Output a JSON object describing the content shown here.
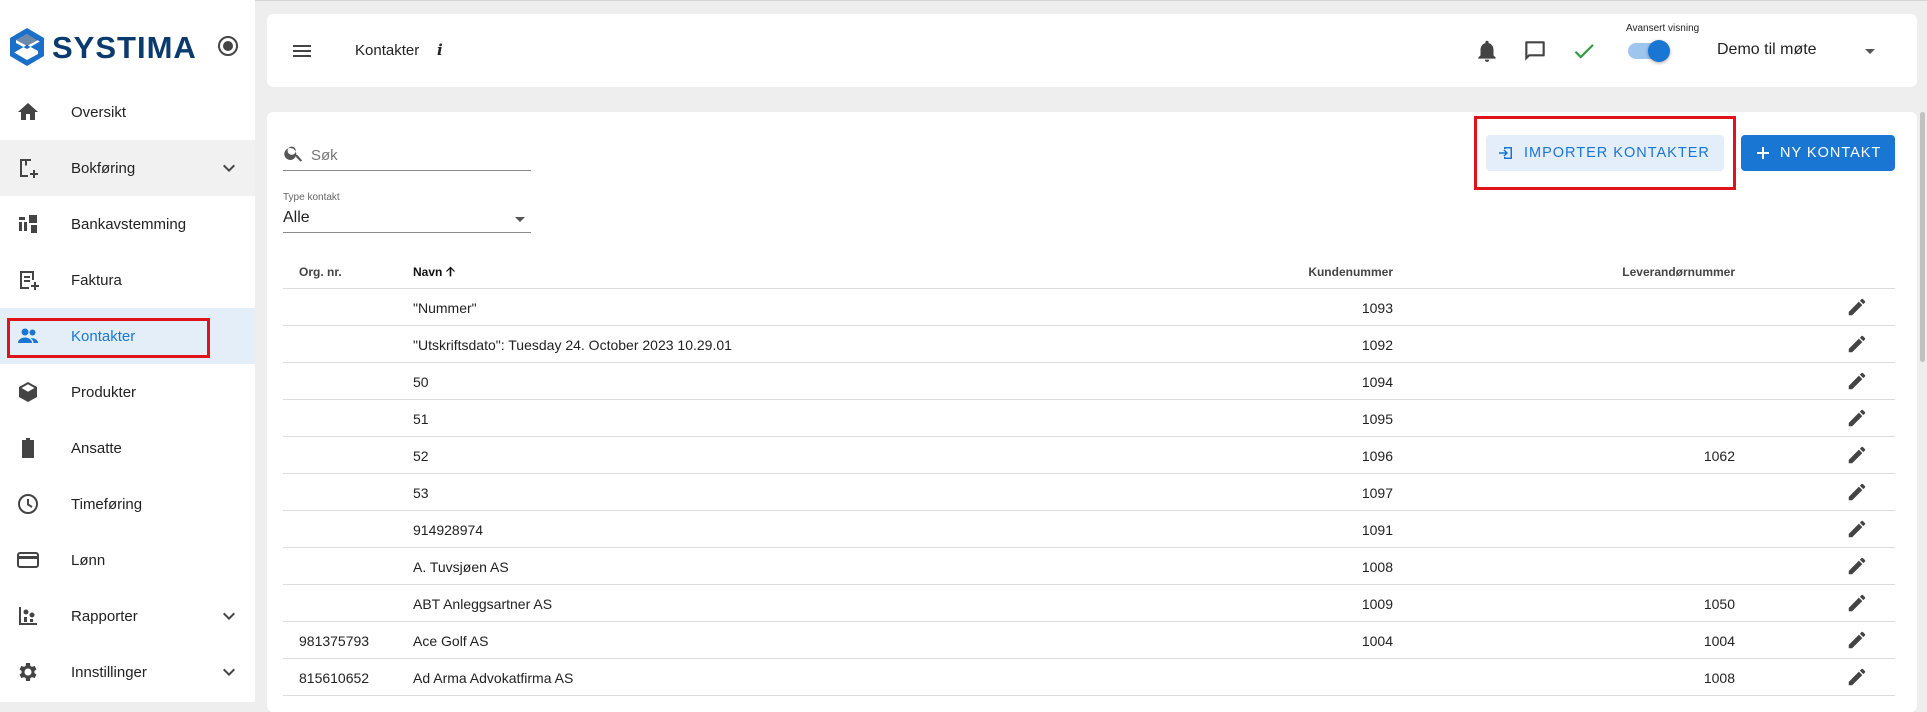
{
  "app": {
    "brand": "SYSTIMA"
  },
  "sidebar": {
    "items": [
      {
        "label": "Oversikt",
        "icon": "home-icon"
      },
      {
        "label": "Bokføring",
        "icon": "bookkeeping-icon",
        "expandable": true
      },
      {
        "label": "Bankavstemming",
        "icon": "bank-reconcile-icon"
      },
      {
        "label": "Faktura",
        "icon": "invoice-icon"
      },
      {
        "label": "Kontakter",
        "icon": "people-icon",
        "active": true
      },
      {
        "label": "Produkter",
        "icon": "box-icon"
      },
      {
        "label": "Ansatte",
        "icon": "badge-icon"
      },
      {
        "label": "Timeføring",
        "icon": "clock-icon"
      },
      {
        "label": "Lønn",
        "icon": "card-icon"
      },
      {
        "label": "Rapporter",
        "icon": "reports-icon",
        "expandable": true
      },
      {
        "label": "Innstillinger",
        "icon": "gear-icon",
        "expandable": true
      }
    ]
  },
  "header": {
    "title": "Kontakter",
    "info": "i",
    "toggle_caption": "Avansert visning",
    "toggle_on": true,
    "company": "Demo til møte"
  },
  "toolbar": {
    "search_placeholder": "Søk",
    "type_label": "Type kontakt",
    "type_value": "Alle",
    "import_label": "IMPORTER KONTAKTER",
    "new_label": "NY KONTAKT"
  },
  "table": {
    "columns": {
      "org": "Org. nr.",
      "navn": "Navn",
      "kunde": "Kundenummer",
      "lev": "Leverandørnummer"
    },
    "rows": [
      {
        "org": "",
        "navn": "\"Nummer\"",
        "kunde": "1093",
        "lev": ""
      },
      {
        "org": "",
        "navn": "\"Utskriftsdato\": Tuesday 24. October 2023 10.29.01",
        "kunde": "1092",
        "lev": ""
      },
      {
        "org": "",
        "navn": "50",
        "kunde": "1094",
        "lev": ""
      },
      {
        "org": "",
        "navn": "51",
        "kunde": "1095",
        "lev": ""
      },
      {
        "org": "",
        "navn": "52",
        "kunde": "1096",
        "lev": "1062"
      },
      {
        "org": "",
        "navn": "53",
        "kunde": "1097",
        "lev": ""
      },
      {
        "org": "",
        "navn": "914928974",
        "kunde": "1091",
        "lev": ""
      },
      {
        "org": "",
        "navn": "A. Tuvsjøen AS",
        "kunde": "1008",
        "lev": ""
      },
      {
        "org": "",
        "navn": "ABT Anleggsartner AS",
        "kunde": "1009",
        "lev": "1050"
      },
      {
        "org": "981375793",
        "navn": "Ace Golf AS",
        "kunde": "1004",
        "lev": "1004"
      },
      {
        "org": "815610652",
        "navn": "Ad Arma Advokatfirma AS",
        "kunde": "",
        "lev": "1008"
      }
    ]
  },
  "colors": {
    "accent": "#1976d2",
    "highlight_box": "#e0131a",
    "brand_blue": "#0b3a6f",
    "success_check": "#2e9e3f"
  }
}
